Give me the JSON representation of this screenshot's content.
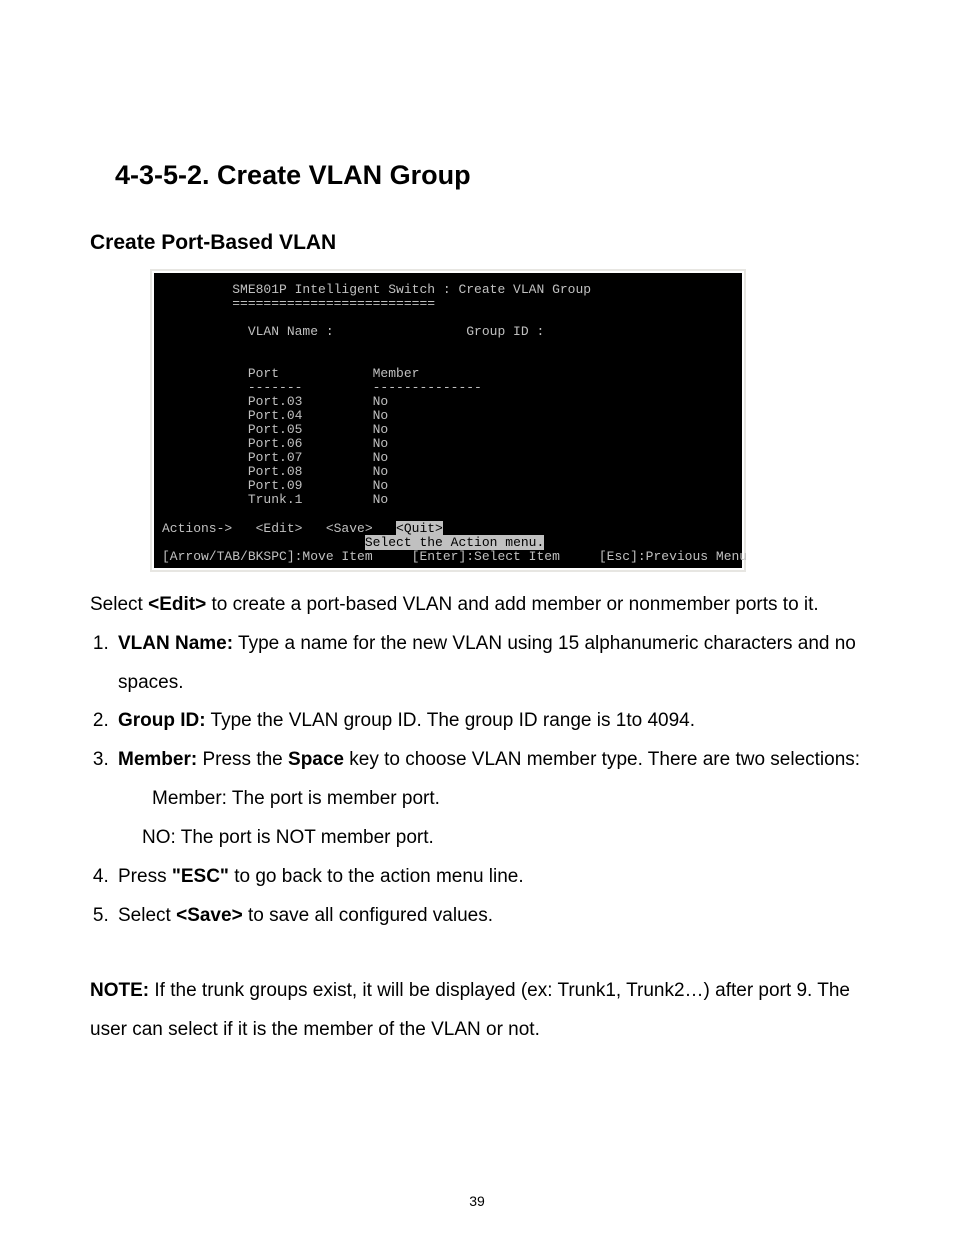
{
  "page_number": "39",
  "heading_number": "4-3-5-2. ",
  "heading_title": "Create VLAN Group",
  "subheading": "Create Port-Based VLAN",
  "terminal": {
    "title": "SME801P Intelligent Switch : Create VLAN Group",
    "divider": "==========================",
    "vlan_name_label": "VLAN Name :",
    "group_id_label": "Group ID :",
    "col_port": "Port",
    "col_member": "Member",
    "rows": [
      {
        "port": "Port.03",
        "member": "No"
      },
      {
        "port": "Port.04",
        "member": "No"
      },
      {
        "port": "Port.05",
        "member": "No"
      },
      {
        "port": "Port.06",
        "member": "No"
      },
      {
        "port": "Port.07",
        "member": "No"
      },
      {
        "port": "Port.08",
        "member": "No"
      },
      {
        "port": "Port.09",
        "member": "No"
      },
      {
        "port": "Trunk.1",
        "member": "No"
      }
    ],
    "col_div_port": "-------",
    "col_div_member": "--------------",
    "actions_label": "Actions->",
    "edit": "<Edit>",
    "save": "<Save>",
    "quit": "<Quit>",
    "hint_select_action": "Select the Action menu.",
    "help_move": "[Arrow/TAB/BKSPC]:Move Item",
    "help_enter": "[Enter]:Select Item",
    "help_esc": "[Esc]:Previous Menu"
  },
  "intro_a": "Select ",
  "intro_b": "<Edit>",
  "intro_c": " to create a port-based VLAN and add member or nonmember ports to it.",
  "steps": {
    "s1_b": "VLAN Name:",
    "s1_t": " Type a name for the new VLAN using 15 alphanumeric characters and no spaces.",
    "s2_b": "Group ID:",
    "s2_t": " Type the VLAN group ID. The group ID range is 1to 4094.",
    "s3_b": "Member: ",
    "s3_t1": "  Press the ",
    "s3_tk": "Space",
    "s3_t2": " key to choose VLAN member type. There are two selections:",
    "s3_opt1": "Member: The port is member port.",
    "s3_opt2": "NO: The port is NOT member port.",
    "s4_a": "Press ",
    "s4_b": "\"ESC\"",
    "s4_c": " to go back to the action menu line.",
    "s5_a": "Select ",
    "s5_b": "<Save>",
    "s5_c": " to save all configured values."
  },
  "note_b": "NOTE:",
  "note_t": " If the trunk groups exist, it will be displayed (ex: Trunk1, Trunk2…) after port 9. The user can select if it is the member of the VLAN or not."
}
